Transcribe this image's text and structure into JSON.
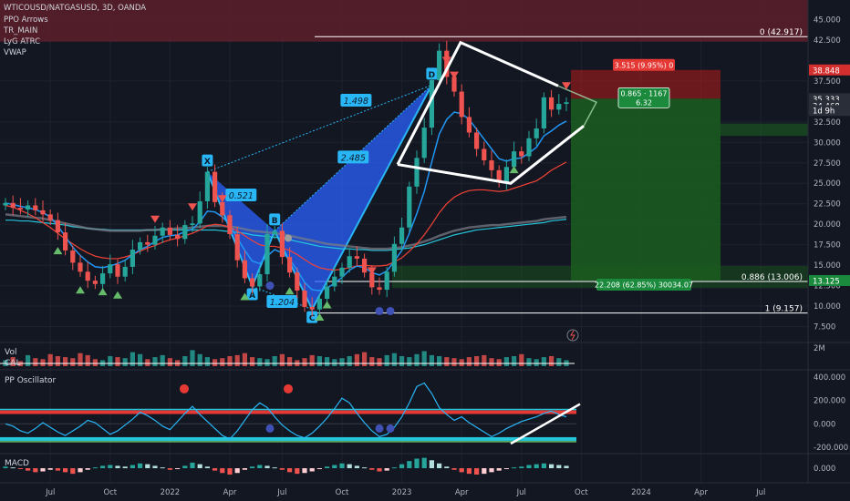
{
  "header": {
    "title": "WTICOUSD/NATGASUSD, 3D, OANDA",
    "indicators": [
      "PPO Arrows",
      "TR_MAIN",
      "LyG ATRC",
      "VWAP"
    ]
  },
  "chart_data": [
    {
      "type": "line",
      "panel": "price",
      "x_labels": [
        "Jul",
        "Oct",
        "2022",
        "Apr",
        "Jul",
        "Oct",
        "2023",
        "Apr",
        "Jul",
        "Oct",
        "2024",
        "Apr",
        "Jul"
      ],
      "y_ticks": [
        "45.000",
        "42.500",
        "37.500",
        "32.500",
        "30.000",
        "27.500",
        "25.000",
        "22.500",
        "20.000",
        "17.500",
        "15.000",
        "12.500",
        "10.000",
        "7.500"
      ],
      "ylim": [
        6.0,
        46.5
      ],
      "series": [
        {
          "values": [
            22.6,
            22.0,
            21.8,
            22.3,
            21.7,
            21.2,
            20.5,
            19.0,
            16.8,
            15.3,
            14.2,
            13.1,
            12.7,
            14.0,
            15.1,
            13.6,
            14.8,
            16.9,
            17.8,
            17.5,
            18.6,
            19.6,
            18.7,
            18.2,
            19.9,
            20.1,
            22.8,
            26.4,
            22.7,
            21.1,
            18.8,
            15.6,
            13.4,
            12.4,
            13.9,
            18.8,
            19.2,
            16.0,
            14.1,
            11.9,
            9.9,
            9.6,
            10.9,
            12.4,
            13.6,
            14.7,
            16.1,
            15.8,
            14.1,
            12.3,
            12.0,
            14.2,
            17.6,
            19.6,
            24.6,
            28.1,
            31.8,
            37.6,
            41.2,
            38.0,
            36.2,
            33.1,
            31.2,
            29.2,
            27.8,
            26.6,
            25.1,
            27.0,
            28.9,
            28.3,
            30.5,
            31.7,
            35.5,
            34.0,
            34.7,
            34.9
          ]
        },
        {
          "values": [
            22.6,
            22.4,
            22.2,
            22.0,
            21.8,
            21.4,
            20.9,
            19.8,
            18.5,
            17.2,
            16.2,
            15.4,
            14.8,
            14.7,
            14.9,
            15.2,
            15.6,
            16.3,
            16.9,
            17.3,
            17.9,
            18.4,
            18.6,
            18.7,
            19.1,
            19.4,
            20.3,
            21.6,
            21.5,
            20.9,
            19.9,
            18.3,
            16.8,
            15.5,
            15.2,
            16.1,
            16.9,
            16.5,
            15.7,
            14.4,
            12.9,
            12.0,
            11.9,
            12.2,
            12.8,
            13.5,
            14.4,
            14.9,
            14.7,
            14.1,
            13.8,
            14.3,
            15.5,
            16.8,
            18.9,
            21.3,
            24.0,
            27.6,
            31.0,
            32.8,
            33.7,
            33.5,
            32.8,
            31.6,
            30.4,
            29.2,
            28.0,
            27.7,
            28.0,
            28.1,
            28.7,
            29.4,
            30.8,
            31.4,
            32.1,
            32.6
          ]
        },
        {
          "values": [
            22.3,
            22.1,
            21.7,
            21.3,
            20.8,
            20.2,
            19.6,
            18.9,
            18.2,
            17.6,
            17.0,
            16.5,
            16.1,
            15.9,
            15.8,
            15.8,
            16.0,
            16.3,
            16.7,
            17.1,
            17.4,
            17.8,
            18.1,
            18.3,
            18.6,
            18.9,
            19.3,
            19.8,
            20.0,
            19.9,
            19.6,
            19.2,
            18.6,
            18.0,
            17.5,
            17.3,
            17.3,
            17.1,
            16.8,
            16.3,
            15.7,
            15.1,
            14.7,
            14.5,
            14.4,
            14.5,
            14.7,
            14.9,
            15.0,
            14.9,
            14.9,
            15.0,
            15.4,
            15.9,
            16.7,
            17.6,
            18.7,
            20.0,
            21.4,
            22.5,
            23.3,
            23.8,
            24.1,
            24.2,
            24.2,
            24.1,
            24.0,
            24.1,
            24.4,
            24.7,
            25.0,
            25.3,
            25.9,
            26.6,
            27.1,
            27.6
          ]
        },
        {
          "values": [
            21.2,
            21.1,
            21.0,
            20.9,
            20.8,
            20.7,
            20.5,
            20.3,
            20.1,
            19.9,
            19.7,
            19.5,
            19.4,
            19.3,
            19.2,
            19.2,
            19.2,
            19.2,
            19.2,
            19.3,
            19.3,
            19.4,
            19.4,
            19.5,
            19.5,
            19.6,
            19.7,
            19.8,
            19.8,
            19.8,
            19.7,
            19.6,
            19.4,
            19.2,
            19.1,
            19.0,
            18.9,
            18.8,
            18.6,
            18.4,
            18.2,
            18.0,
            17.8,
            17.6,
            17.5,
            17.4,
            17.3,
            17.2,
            17.1,
            17.0,
            17.0,
            17.0,
            17.1,
            17.2,
            17.4,
            17.6,
            17.9,
            18.2,
            18.6,
            18.9,
            19.2,
            19.4,
            19.6,
            19.7,
            19.8,
            19.9,
            19.9,
            20.0,
            20.1,
            20.2,
            20.3,
            20.4,
            20.6,
            20.7,
            20.8,
            20.9
          ]
        },
        {
          "values": [
            20.5,
            20.5,
            20.4,
            20.4,
            20.3,
            20.2,
            20.1,
            20.0,
            19.9,
            19.7,
            19.6,
            19.5,
            19.4,
            19.4,
            19.3,
            19.3,
            19.3,
            19.3,
            19.3,
            19.3,
            19.3,
            19.3,
            19.3,
            19.3,
            19.3,
            19.3,
            19.3,
            19.3,
            19.3,
            19.2,
            19.1,
            19.0,
            18.9,
            18.7,
            18.6,
            18.5,
            18.4,
            18.3,
            18.1,
            17.9,
            17.7,
            17.5,
            17.3,
            17.2,
            17.1,
            17.0,
            17.0,
            16.9,
            16.9,
            16.8,
            16.8,
            16.8,
            16.9,
            17.0,
            17.1,
            17.3,
            17.5,
            17.8,
            18.1,
            18.4,
            18.7,
            18.9,
            19.1,
            19.3,
            19.4,
            19.5,
            19.6,
            19.7,
            19.8,
            19.9,
            20.0,
            20.1,
            20.2,
            20.4,
            20.5,
            20.6
          ]
        }
      ],
      "price_lines": [
        {
          "value": 42.917,
          "label": "0 (42.917)"
        },
        {
          "value": 13.006,
          "label": "0.886 (13.006)"
        },
        {
          "value": 9.157,
          "label": "1 (9.157)"
        }
      ],
      "pattern": {
        "points": [
          {
            "label": "X",
            "value": 26.4
          },
          {
            "label": "A",
            "value": 12.4
          },
          {
            "label": "B",
            "value": 19.2
          },
          {
            "label": "C",
            "value": 9.6
          },
          {
            "label": "D",
            "value": 37.0
          }
        ],
        "ratios": [
          "0.521",
          "1.498",
          "1.204",
          "2.485"
        ]
      },
      "position": {
        "entry": 35.333,
        "stop": 38.848,
        "target": 13.125,
        "risk_label": "3.515 (9.95%) 0",
        "reward_label": "22.208 (62.85%) 30034.07",
        "ratio_label": "0.865 · 1167",
        "ratio_value": "6.32"
      },
      "price_badges": [
        {
          "value": 38.848,
          "label": "38.848",
          "color": "#d32f2f"
        },
        {
          "value": 35.333,
          "label": "35.333",
          "color": "#2a2e39"
        },
        {
          "value": 34.468,
          "label": "34.468",
          "color": "#2a2e39"
        },
        {
          "value": 33.9,
          "label": "1d 9h",
          "color": "#2a2e39"
        },
        {
          "value": 13.125,
          "label": "13.125",
          "color": "#1b8a3c"
        }
      ]
    },
    {
      "type": "bar",
      "panel": "volume",
      "labels": [
        "Vol",
        "CAL"
      ],
      "y_ticks": [
        "2M"
      ],
      "values": [
        0.3,
        0.45,
        0.25,
        0.55,
        0.4,
        0.35,
        0.6,
        0.5,
        0.45,
        0.4,
        0.65,
        0.55,
        0.35,
        0.3,
        0.5,
        0.45,
        0.4,
        0.7,
        0.6,
        0.35,
        0.45,
        0.55,
        0.4,
        0.3,
        0.5,
        0.8,
        0.6,
        0.45,
        0.35,
        0.4,
        0.5,
        0.55,
        0.65,
        0.45,
        0.4,
        0.35,
        0.5,
        0.6,
        0.45,
        0.3,
        0.4,
        0.55,
        0.5,
        0.45,
        0.35,
        0.4,
        0.5,
        0.6,
        0.7,
        0.45,
        0.4,
        0.55,
        0.65,
        0.5,
        0.45,
        0.6,
        0.75,
        0.55,
        0.5,
        0.45,
        0.4,
        0.35,
        0.45,
        0.5,
        0.55,
        0.4,
        0.35,
        0.45,
        0.5,
        0.6,
        0.4,
        0.35,
        0.45,
        0.5,
        0.4,
        0.3
      ]
    },
    {
      "type": "line",
      "panel": "pp_oscillator",
      "title": "PP Oscillator",
      "y_ticks": [
        "400.000",
        "200.000",
        "0.000",
        "-200.000"
      ],
      "ylim": [
        -240,
        440
      ],
      "values": [
        0,
        -20,
        -60,
        -80,
        -40,
        10,
        -30,
        -70,
        -100,
        -60,
        -20,
        30,
        10,
        -40,
        -90,
        -60,
        -10,
        40,
        100,
        70,
        30,
        -20,
        -50,
        20,
        90,
        150,
        80,
        20,
        -40,
        -100,
        -130,
        -60,
        30,
        120,
        180,
        140,
        60,
        -10,
        -60,
        -100,
        -120,
        -80,
        -20,
        50,
        130,
        220,
        180,
        90,
        10,
        -60,
        -110,
        -90,
        -30,
        60,
        180,
        320,
        350,
        260,
        140,
        80,
        30,
        60,
        10,
        -30,
        -70,
        -110,
        -80,
        -40,
        -10,
        20,
        40,
        60,
        90,
        110,
        80,
        60
      ],
      "upper_band": 100,
      "lower_band": -130,
      "mid_band": 0
    },
    {
      "type": "bar",
      "panel": "macd",
      "title": "MACD",
      "y_ticks": [
        "0.000"
      ],
      "ylim": [
        -1.6,
        1.6
      ],
      "values": [
        0.2,
        0.1,
        -0.1,
        -0.3,
        -0.5,
        -0.4,
        -0.2,
        -0.3,
        -0.5,
        -0.7,
        -0.5,
        -0.2,
        0.1,
        0.3,
        0.4,
        0.3,
        0.2,
        0.4,
        0.6,
        0.5,
        0.3,
        0.1,
        -0.2,
        -0.1,
        0.3,
        0.7,
        0.5,
        0.2,
        -0.3,
        -0.6,
        -0.8,
        -0.6,
        -0.2,
        0.2,
        0.4,
        0.3,
        0.1,
        -0.2,
        -0.5,
        -0.7,
        -0.6,
        -0.4,
        -0.1,
        0.2,
        0.4,
        0.6,
        0.5,
        0.3,
        0.1,
        -0.2,
        -0.4,
        -0.3,
        0.1,
        0.5,
        0.9,
        1.2,
        1.3,
        1.0,
        0.6,
        0.2,
        -0.2,
        -0.5,
        -0.7,
        -0.8,
        -0.7,
        -0.5,
        -0.3,
        -0.1,
        0.1,
        0.2,
        0.4,
        0.5,
        0.6,
        0.5,
        0.4,
        0.3
      ]
    }
  ],
  "colors": {
    "background": "#131722",
    "axis_text": "#b2b5be",
    "grid": "#1e222d",
    "candles_up": "#26a69a",
    "candles_down": "#ef5350",
    "ema_fast": "#2196f3",
    "ema_slow": "#f44336",
    "sma_gray": "#787b86",
    "vwap": "#26c6da",
    "harmonic_fill": "#2962ff",
    "harmonic_line": "#29b6f6",
    "triangle": "#ffffff",
    "position_stop": "#b71c1c",
    "position_target": "#1b5e20",
    "zone_red": "#5d1f2a"
  },
  "watermark_icon": "lightning-icon"
}
